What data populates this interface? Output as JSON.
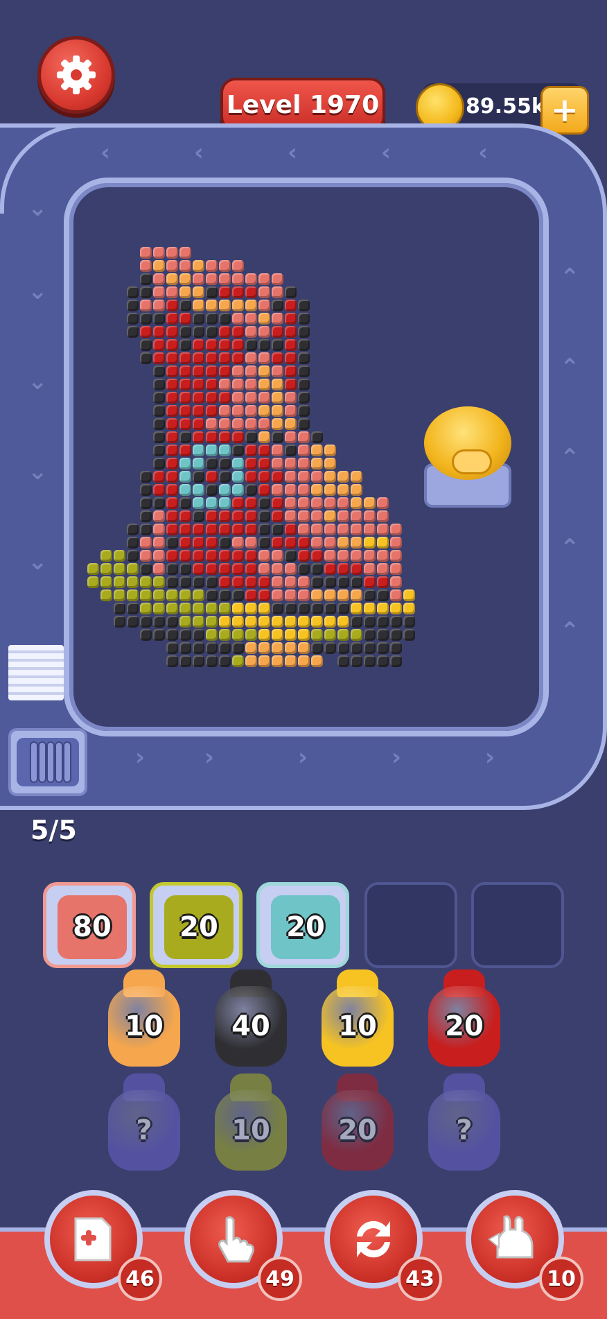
{
  "header": {
    "level_label": "Level 1970",
    "coins": "89.55k",
    "coin_plus": "+"
  },
  "belt": {
    "capacity": "5/5"
  },
  "queue_slots": [
    {
      "value": "80",
      "color": "#e6746b",
      "frame": "#f09a92"
    },
    {
      "value": "20",
      "color": "#a9ab1e",
      "frame": "#c4c82f"
    },
    {
      "value": "20",
      "color": "#6fc4c7",
      "frame": "#9ed8da"
    },
    {
      "value": "",
      "color": "",
      "frame": ""
    },
    {
      "value": "",
      "color": "",
      "frame": ""
    }
  ],
  "grid_row1": [
    {
      "value": "10",
      "color": "#f6a64c"
    },
    {
      "value": "40",
      "color": "#2f2f33"
    },
    {
      "value": "10",
      "color": "#f6c323"
    },
    {
      "value": "20",
      "color": "#c81e1e"
    }
  ],
  "grid_row2": [
    {
      "value": "?",
      "color": "#6a63c9"
    },
    {
      "value": "10",
      "color": "#aab51f"
    },
    {
      "value": "20",
      "color": "#b61d1d"
    },
    {
      "value": "?",
      "color": "#6a63c9"
    }
  ],
  "powerups": [
    {
      "name": "add-slot",
      "count": "46"
    },
    {
      "name": "tap",
      "count": "49"
    },
    {
      "name": "shuffle",
      "count": "43"
    },
    {
      "name": "bunny",
      "count": "10"
    }
  ],
  "colors": {
    "red": "#c81e1e",
    "dark": "#2f2f33",
    "salmon": "#e6746b",
    "orange": "#f6a64c",
    "yellow": "#f6c323",
    "olive": "#a9ab1e",
    "teal": "#6fc4c7"
  }
}
